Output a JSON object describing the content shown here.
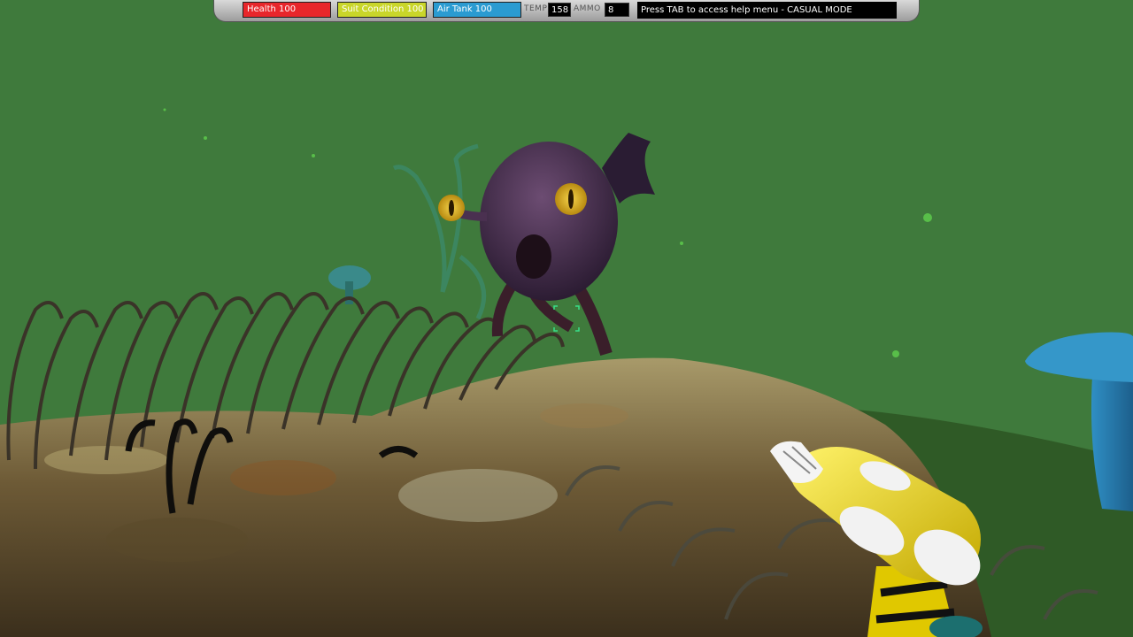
{
  "hud": {
    "health": {
      "label": "Health 100",
      "value": 100,
      "color": "#e8262b"
    },
    "suit": {
      "label": "Suit Condition 100",
      "value": 100,
      "color": "#c9d62a"
    },
    "air": {
      "label": "Air Tank 100",
      "value": 100,
      "color": "#2a9bd1"
    },
    "temp_label": "TEMP",
    "temp_value": "158",
    "ammo_label": "AMMO",
    "ammo_value": "8",
    "message": "Press TAB to access help menu - CASUAL MODE"
  },
  "scene": {
    "water_color": "#3f7a3c",
    "creature": "purple-fish-creature",
    "weapon": "yellow-ray-gun",
    "crosshair": "crosshair-icon"
  }
}
